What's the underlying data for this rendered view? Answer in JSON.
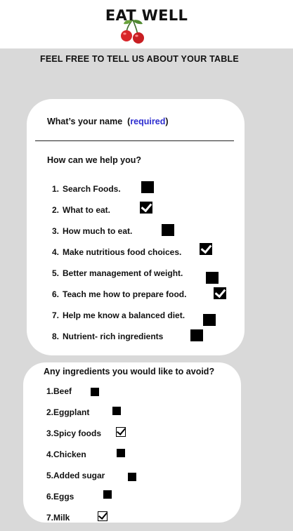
{
  "header": {
    "brand": "EAT WELL",
    "logo_icon": "cherry-icon"
  },
  "intro": "FEEL FREE TO TELL US ABOUT YOUR TABLE",
  "form": {
    "name_label": "What’s your name",
    "required_label": "required",
    "help_title": "How can we help you?",
    "help_items": [
      {
        "num": "1.",
        "label": "Search Foods.",
        "checked": false
      },
      {
        "num": "2.",
        "label": "What to eat.",
        "checked": true
      },
      {
        "num": "3.",
        "label": "How much to eat.",
        "checked": false
      },
      {
        "num": "4.",
        "label": "Make nutritious food choices.",
        "checked": true
      },
      {
        "num": "5.",
        "label": "Better management of weight.",
        "checked": false
      },
      {
        "num": "6.",
        "label": "Teach me how to prepare food.",
        "checked": true
      },
      {
        "num": "7.",
        "label": "Help me know  a balanced diet.",
        "checked": false
      },
      {
        "num": "8.",
        "label": "Nutrient- rich ingredients",
        "checked": false
      }
    ],
    "avoid_title": "Any ingredients you would like to avoid?",
    "avoid_items": [
      {
        "label": "1.Beef",
        "checked": false
      },
      {
        "label": "2.Eggplant",
        "checked": false
      },
      {
        "label": "3.Spicy foods",
        "checked": true
      },
      {
        "label": "4.Chicken",
        "checked": false
      },
      {
        "label": "5.Added sugar",
        "checked": false
      },
      {
        "label": "6.Eggs",
        "checked": false
      },
      {
        "label": "7.Milk",
        "checked": true
      }
    ]
  },
  "colors": {
    "background": "#d9d9d9",
    "required": "#2c2ccf"
  }
}
